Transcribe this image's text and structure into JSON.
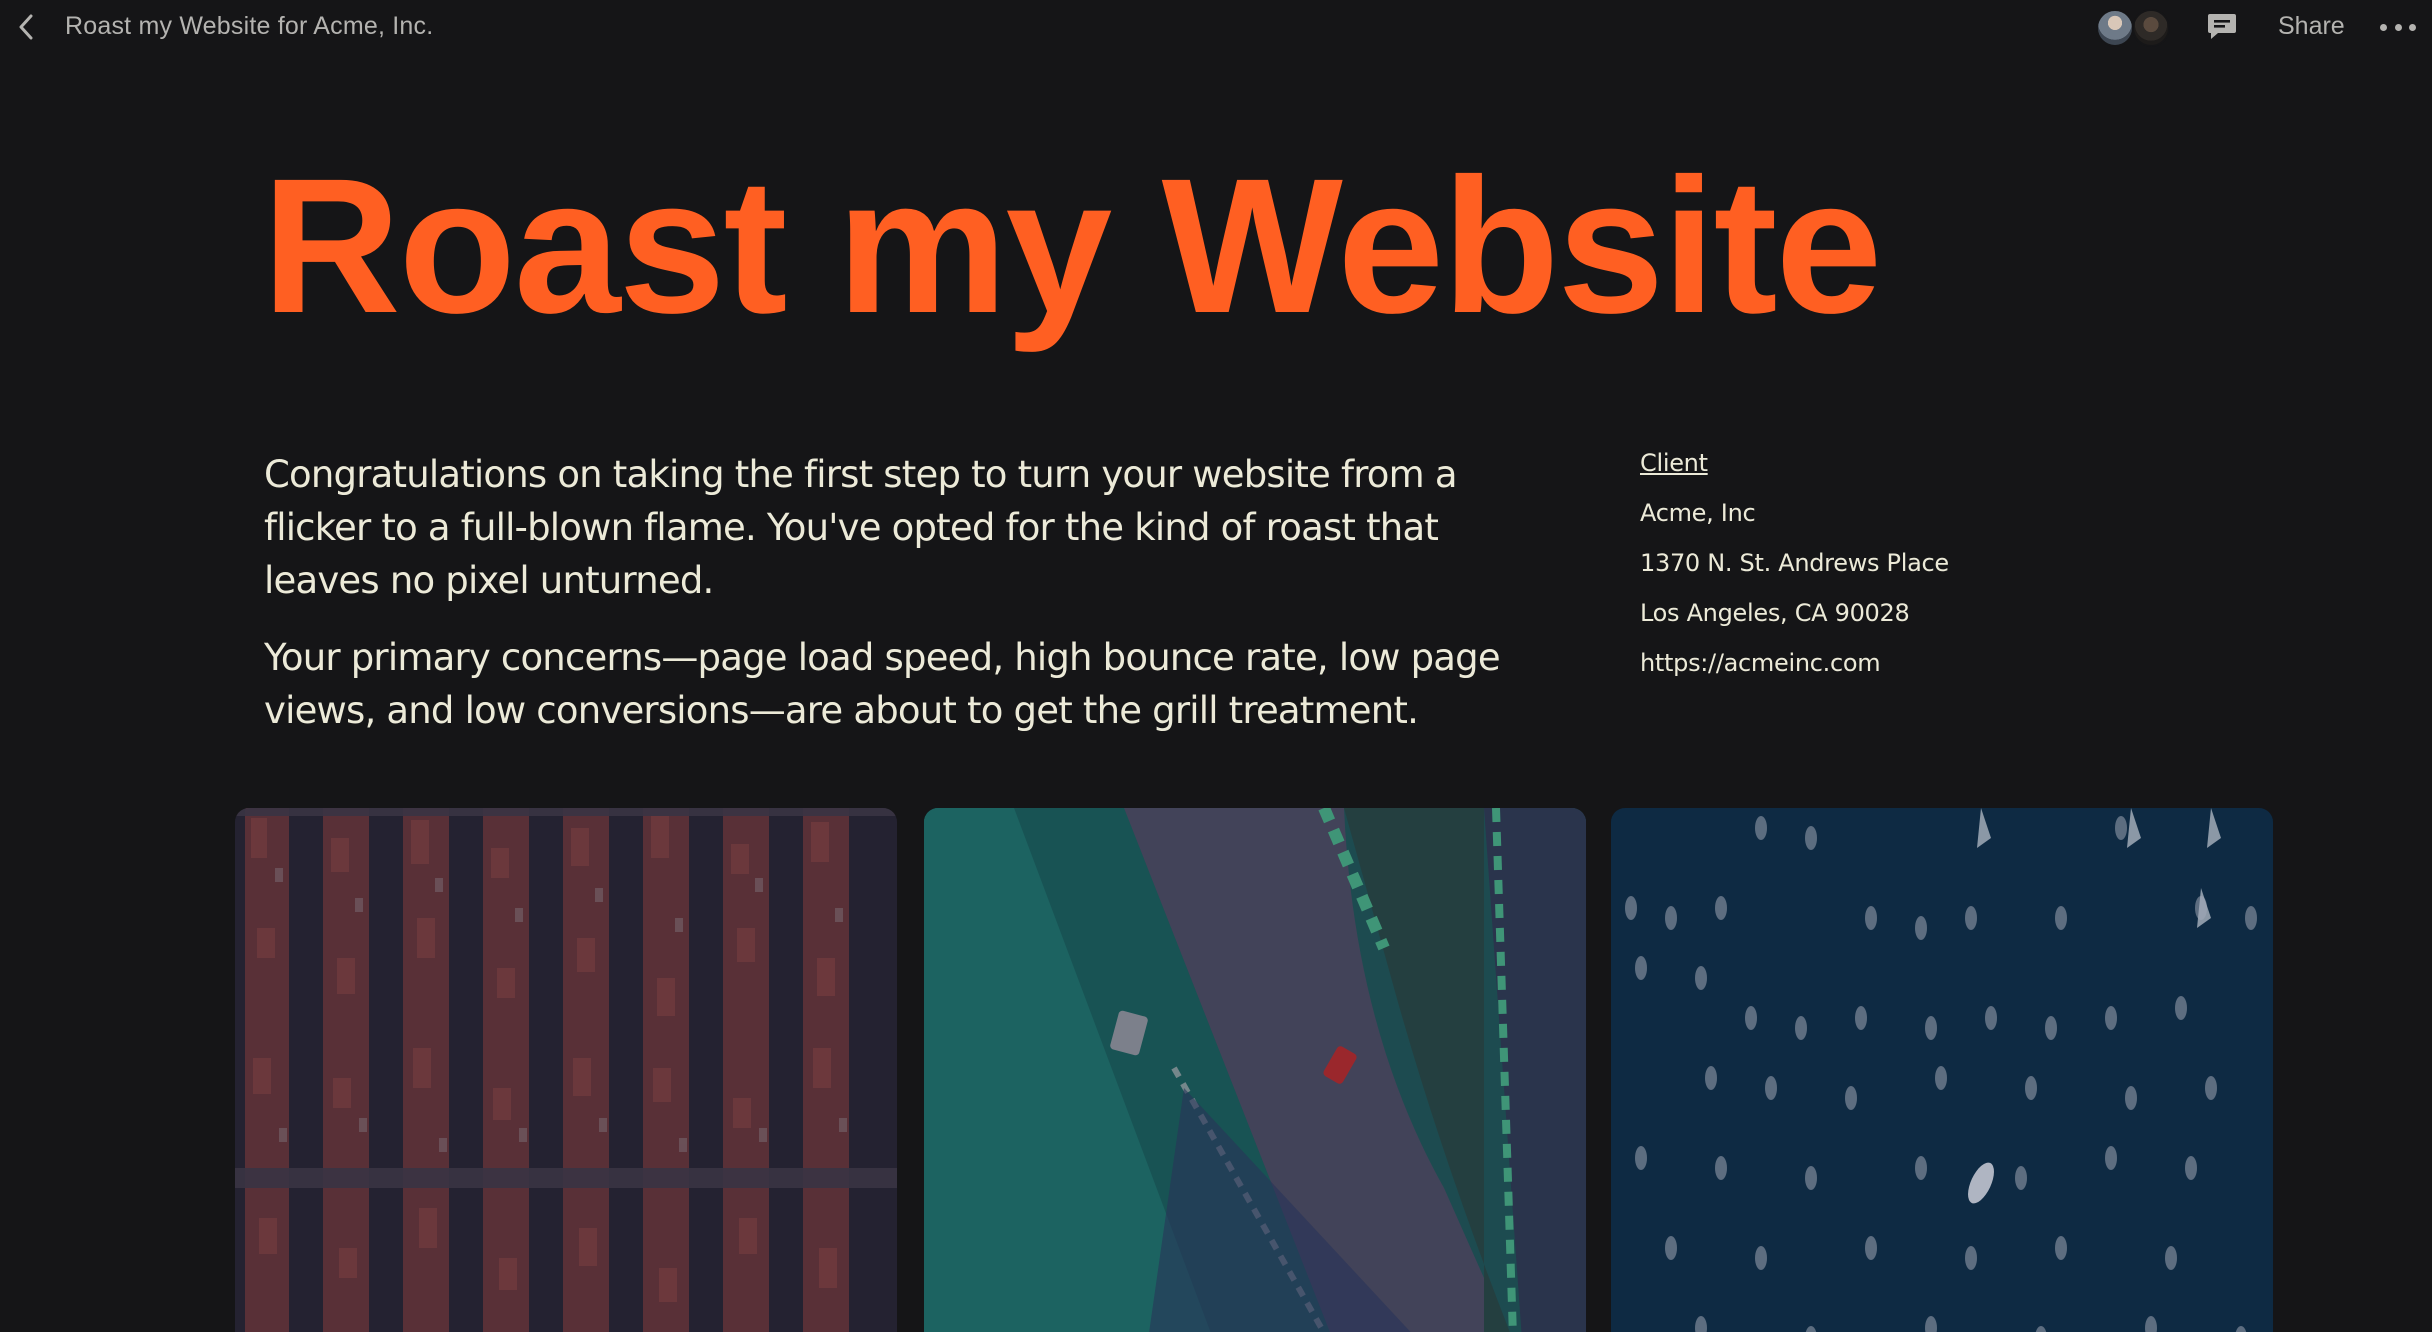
{
  "topbar": {
    "title": "Roast my Website for Acme, Inc.",
    "share_label": "Share",
    "back_icon": "chevron-left-icon",
    "comment_icon": "comment-icon",
    "more_icon": "more-horizontal-icon"
  },
  "hero": {
    "title": "Roast my Website",
    "accent_color": "#ff5f22"
  },
  "intro": {
    "paragraphs": [
      "Congratulations on taking the first step to turn your website from a flicker to a full-blown flame. You've opted for the kind of roast that leaves no pixel unturned.",
      "Your primary concerns—page load speed, high bounce rate, low page views, and low conversions—are about to get the grill treatment."
    ]
  },
  "client": {
    "label": "Client",
    "name": "Acme, Inc",
    "address_line1": "1370 N. St. Andrews Place",
    "address_line2": "Los Angeles, CA 90028",
    "url": "https://acmeinc.com"
  },
  "gallery": {
    "images": [
      {
        "subject": "aerial city blocks"
      },
      {
        "subject": "aerial race track with car"
      },
      {
        "subject": "aerial marina with boats"
      }
    ]
  },
  "colors": {
    "background": "#151517",
    "text": "#ecead8",
    "muted": "#b4b3b0"
  }
}
